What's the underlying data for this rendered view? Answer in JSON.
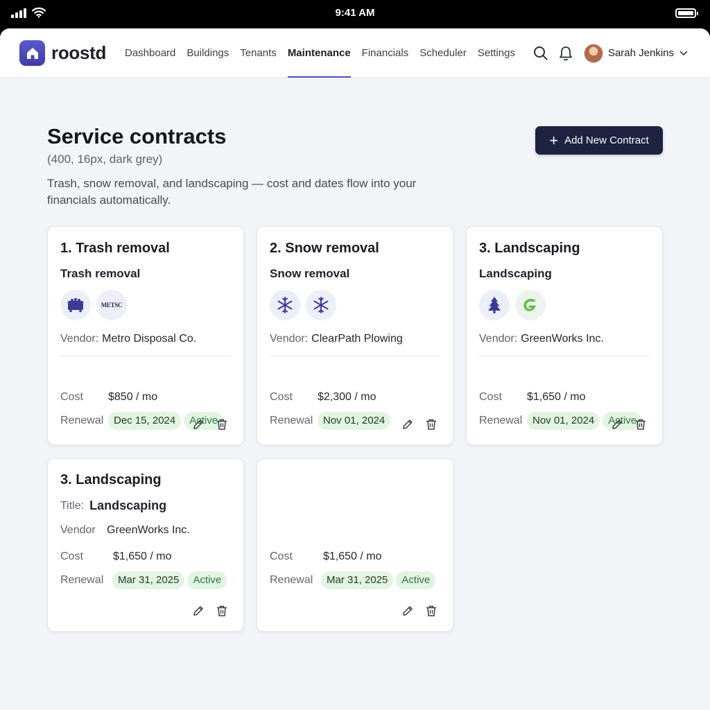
{
  "status_bar": {
    "time": "9:41 AM"
  },
  "app": {
    "name": "roostd"
  },
  "nav": {
    "links": [
      "Dashboard",
      "Buildings",
      "Tenants",
      "Maintenance",
      "Financials",
      "Scheduler",
      "Settings"
    ],
    "active": "Maintenance",
    "user_name": "Sarah Jenkins",
    "accent": "#4f4ebd"
  },
  "page": {
    "title": "Service contracts",
    "note": "(400, 16px, dark grey)",
    "description": "Trash, snow removal, and landscaping — cost and dates flow into your financials automatically.",
    "add_button": "Add New Contract"
  },
  "labels": {
    "vendor": "Vendor:",
    "vendor_plain": "Vendor",
    "title_prefix": "Title:",
    "cost": "Cost",
    "renewal": "Renewal"
  },
  "cards": [
    {
      "title": "1. Trash removal",
      "subtitle": "Trash removal",
      "icons": [
        "dumpster-icon",
        "metsc-logo"
      ],
      "logo_text": "METSC",
      "vendor": "Metro Disposal Co.",
      "cost": "$850 / mo",
      "renewal": "Dec 15, 2024",
      "status": "Active"
    },
    {
      "title": "2. Snow removal",
      "subtitle": "Snow removal",
      "icons": [
        "snowflake-icon",
        "snowflake-icon"
      ],
      "vendor": "ClearPath Plowing",
      "cost": "$2,300 / mo",
      "renewal": "Nov 01, 2024",
      "status": ""
    },
    {
      "title": "3. Landscaping",
      "subtitle": "Landscaping",
      "icons": [
        "tree-icon",
        "greenworks-logo"
      ],
      "vendor": "GreenWorks Inc.",
      "cost": "$1,650 / mo",
      "renewal": "Nov 01, 2024",
      "status": "Active"
    },
    {
      "title": "3. Landscaping",
      "subtitle": "Landscaping",
      "vendor": "GreenWorks Inc.",
      "cost": "$1,650 / mo",
      "renewal": "Mar 31, 2025",
      "status": "Active"
    },
    {
      "cost": "$1,650 / mo",
      "renewal": "Mar 31, 2025",
      "status": "Active"
    }
  ],
  "colors": {
    "primary_button": "#1d2340",
    "chip_bg": "#e3f4e3",
    "chip_status_text": "#2e7a3a"
  }
}
